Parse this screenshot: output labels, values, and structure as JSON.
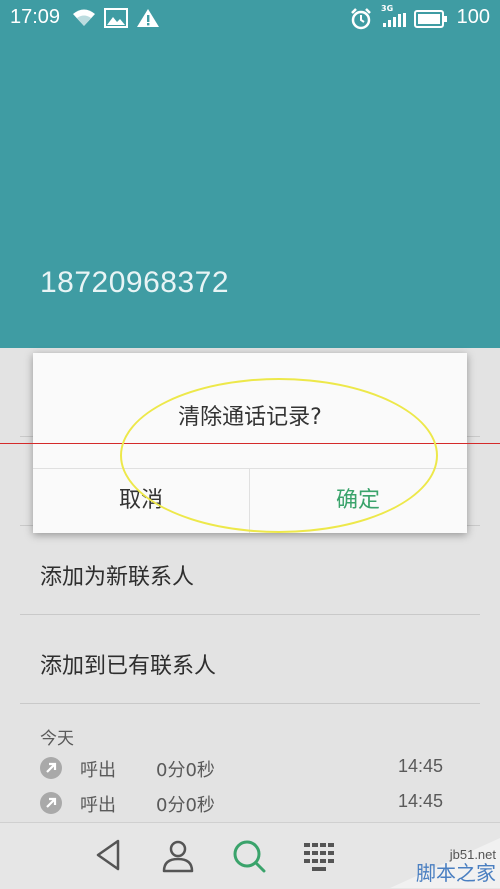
{
  "status_bar": {
    "time": "17:09",
    "network_label": "3G",
    "battery": "100",
    "icons": [
      "wifi-icon",
      "image-icon",
      "warning-icon",
      "alarm-icon",
      "signal-icon",
      "battery-icon"
    ]
  },
  "contact": {
    "phone_number": "18720968372"
  },
  "actions": {
    "add_new_contact": "添加为新联系人",
    "add_existing_contact": "添加到已有联系人"
  },
  "call_log": {
    "section_title": "今天",
    "entries": [
      {
        "type": "呼出",
        "duration": "0分0秒",
        "time": "14:45"
      },
      {
        "type": "呼出",
        "duration": "0分0秒",
        "time": "14:45"
      }
    ]
  },
  "dialog": {
    "message": "清除通话记录?",
    "cancel_label": "取消",
    "confirm_label": "确定"
  },
  "navbar": {
    "icons": [
      "back-icon",
      "contacts-icon",
      "search-icon",
      "dialpad-icon"
    ]
  },
  "watermark": {
    "url": "jb51.net",
    "text": "脚本之家"
  },
  "colors": {
    "header": "#3f9ca3",
    "accent_green": "#3aa36b",
    "annotation_yellow": "#ede84a",
    "annotation_red": "#d42a2a"
  }
}
